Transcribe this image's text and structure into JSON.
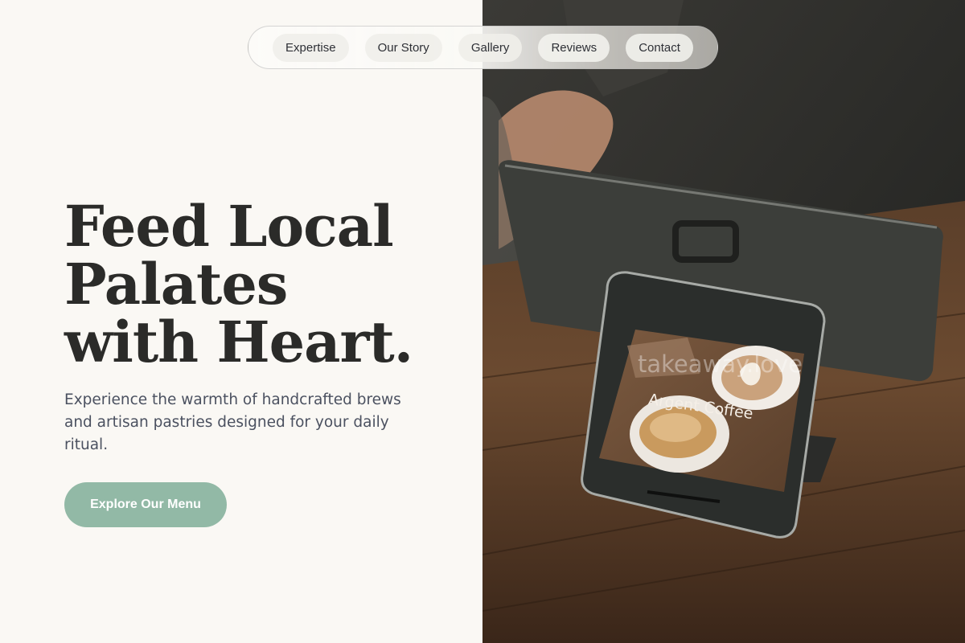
{
  "nav": {
    "items": [
      {
        "label": "Expertise"
      },
      {
        "label": "Our Story"
      },
      {
        "label": "Gallery"
      },
      {
        "label": "Reviews"
      },
      {
        "label": "Contact"
      }
    ]
  },
  "hero": {
    "title_line1": "Feed Local",
    "title_line2": "Palates",
    "title_line3": "with Heart.",
    "subtitle": "Experience the warmth of handcrafted brews and artisan pastries designed for your daily ritual.",
    "cta_label": "Explore Our Menu"
  },
  "photo": {
    "watermark": "takeaway.love",
    "screen_caption": "Argent Coffee"
  },
  "colors": {
    "background": "#faf8f4",
    "accent": "#92b9a6",
    "title": "#2b2b29",
    "subtitle": "#4b5160"
  }
}
